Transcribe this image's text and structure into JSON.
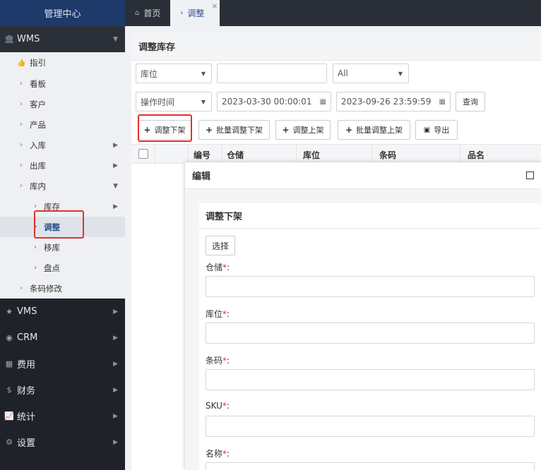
{
  "app": {
    "title": "管理中心"
  },
  "sidebar": {
    "wms": {
      "label": "WMS",
      "icon": "bank-icon"
    },
    "wms_items": [
      {
        "label": "指引",
        "icon": "thumb-up-icon"
      },
      {
        "label": "看板"
      },
      {
        "label": "客户"
      },
      {
        "label": "产品"
      },
      {
        "label": "入库"
      },
      {
        "label": "出库"
      },
      {
        "label": "库内"
      },
      {
        "label": "库存"
      },
      {
        "label": "调整"
      },
      {
        "label": "移库"
      },
      {
        "label": "盘点"
      },
      {
        "label": "条码修改"
      }
    ],
    "groups": [
      {
        "label": "VMS",
        "icon": "star-icon"
      },
      {
        "label": "CRM",
        "icon": "user-icon"
      },
      {
        "label": "费用",
        "icon": "table-icon"
      },
      {
        "label": "财务",
        "icon": "dollar-icon"
      },
      {
        "label": "统计",
        "icon": "chart-icon"
      },
      {
        "label": "设置",
        "icon": "gear-icon"
      }
    ]
  },
  "tabs": [
    {
      "label": "首页",
      "icon": "home-icon"
    },
    {
      "label": "调整",
      "icon": "chevron-right-icon",
      "active": true
    }
  ],
  "page": {
    "title": "调整库存",
    "filters": {
      "location_select": "库位",
      "location_input": "",
      "status_select": "All",
      "time_type": "操作时间",
      "start_time": "2023-03-30 00:00:01",
      "end_time": "2023-09-26 23:59:59",
      "query_button": "查询"
    },
    "toolbar": {
      "adjust_down": "调整下架",
      "batch_adjust_down": "批量调整下架",
      "adjust_up": "调整上架",
      "batch_adjust_up": "批量调整上架",
      "export": "导出"
    },
    "table": {
      "columns": [
        "编号",
        "仓储",
        "库位",
        "条码",
        "品名"
      ]
    }
  },
  "modal": {
    "title": "编辑",
    "section_title": "调整下架",
    "select_button": "选择",
    "fields": [
      {
        "label": "仓储",
        "value": ""
      },
      {
        "label": "库位",
        "value": ""
      },
      {
        "label": "条码",
        "value": ""
      },
      {
        "label": "SKU",
        "value": ""
      },
      {
        "label": "名称",
        "value": ""
      }
    ],
    "required_mark": "*",
    "label_suffix": ":"
  },
  "colors": {
    "sidebar_bg": "#1f2329",
    "brand_bg": "#1d3a6b",
    "accent": "#2c4f8c",
    "highlight_box": "#e0322b"
  }
}
